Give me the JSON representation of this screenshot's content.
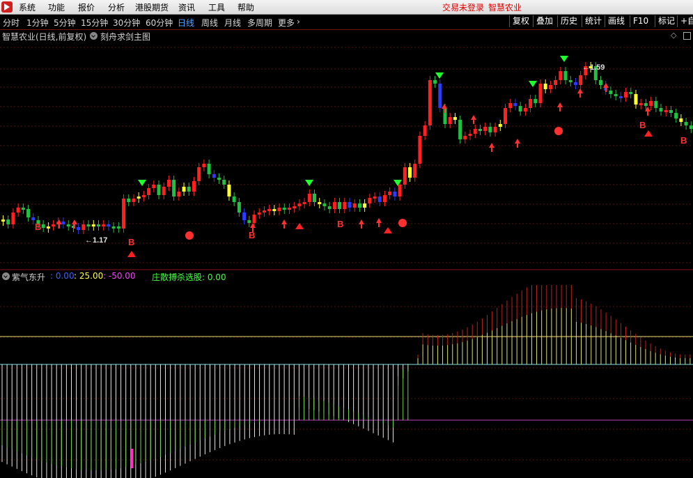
{
  "menubar": {
    "items": [
      "系统",
      "功能",
      "报价",
      "分析",
      "港股期货",
      "资讯",
      "工具",
      "帮助"
    ],
    "login_status": "交易未登录",
    "stock_name": "智慧农业"
  },
  "toolbar": {
    "periods": [
      "分时",
      "1分钟",
      "5分钟",
      "15分钟",
      "30分钟",
      "60分钟",
      "日线",
      "周线",
      "月线",
      "多周期",
      "更多"
    ],
    "active_period": "日线",
    "right_buttons": [
      "复权",
      "叠加",
      "历史",
      "统计",
      "画线",
      "F10",
      "标记",
      "+自"
    ]
  },
  "main_title": {
    "stock": "智慧农业(日线,前复权)",
    "indicator": "刻舟求剑主图"
  },
  "annotations": {
    "low": "1.17",
    "high": "1.59",
    "buy_label": "B"
  },
  "sub_indicator": {
    "name": "紫气东升",
    "v1": ": 0.00",
    "v2": ": 25.00",
    "v3": ": -50.00",
    "label2": "庄散搏杀选股: 0.00",
    "colors": {
      "v1": "#4060ff",
      "v2": "#ffff40",
      "v3": "#ff40ff",
      "label2": "#40ff40"
    }
  },
  "chart_data": {
    "type": "candlestick",
    "price_low_annotation": 1.17,
    "price_high_annotation": 1.59,
    "sub_levels": [
      25,
      0,
      -50
    ]
  }
}
